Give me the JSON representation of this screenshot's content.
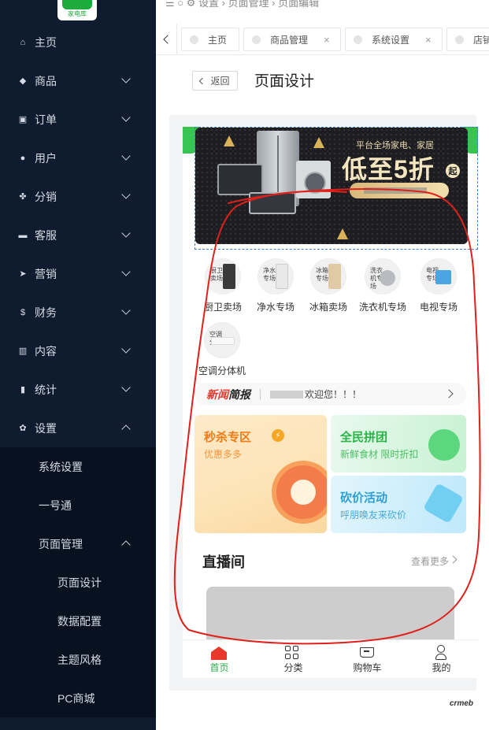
{
  "sidebar": {
    "logo_text": "家电库",
    "menu": [
      {
        "label": "主页",
        "icon": "home-icon",
        "glyph": "⌂"
      },
      {
        "label": "商品",
        "icon": "goods-bag-icon",
        "glyph": "◆"
      },
      {
        "label": "订单",
        "icon": "cart-icon",
        "glyph": "▣"
      },
      {
        "label": "用户",
        "icon": "user-icon",
        "glyph": "●"
      },
      {
        "label": "分销",
        "icon": "distribution-icon",
        "glyph": "✤"
      },
      {
        "label": "客服",
        "icon": "chat-icon",
        "glyph": "▬"
      },
      {
        "label": "营销",
        "icon": "send-icon",
        "glyph": "➤"
      },
      {
        "label": "财务",
        "icon": "dollar-icon",
        "glyph": "$"
      },
      {
        "label": "内容",
        "icon": "book-icon",
        "glyph": "▥"
      },
      {
        "label": "统计",
        "icon": "bar-chart-icon",
        "glyph": "▮"
      },
      {
        "label": "设置",
        "icon": "gear-icon",
        "glyph": "✿"
      }
    ],
    "settings_sub": [
      "系统设置",
      "一号通",
      "页面管理"
    ],
    "page_mgmt_sub": [
      "页面设计",
      "数据配置",
      "主题风格",
      "PC商城"
    ]
  },
  "topbar": {
    "breadcrumb": "☰   ○  ⚙ 设置  ›  页面管理  ›  页面编辑"
  },
  "tabs": [
    {
      "label": "主页",
      "closable": false
    },
    {
      "label": "商品管理",
      "closable": true
    },
    {
      "label": "系统设置",
      "closable": true
    },
    {
      "label": "店铺",
      "closable": false
    }
  ],
  "header": {
    "back_label": "返回",
    "title": "页面设计"
  },
  "phone": {
    "banner": {
      "subtitle": "平台全场家电、家居",
      "headline": "低至5折",
      "badge": "起"
    },
    "categories": [
      {
        "label": "厨卫卖场",
        "img_text": "厨卫卖场"
      },
      {
        "label": "净水专场",
        "img_text": "净水专场"
      },
      {
        "label": "冰箱卖场",
        "img_text": "冰箱专场"
      },
      {
        "label": "洗衣机专场",
        "img_text": "洗衣机专场"
      },
      {
        "label": "电视专场",
        "img_text": "电视专场"
      },
      {
        "label": "空调分体机",
        "img_text": "空调分体"
      }
    ],
    "news": {
      "label_a": "新闻",
      "label_b": "简报",
      "text": "欢迎您！！！"
    },
    "seckill": {
      "title": "秒杀专区",
      "subtitle": "优惠多多"
    },
    "group": {
      "title": "全民拼团",
      "subtitle": "新鲜食材 限时折扣"
    },
    "bargain": {
      "title": "砍价活动",
      "subtitle": "呼朋唤友来砍价"
    },
    "live": {
      "title": "直播间",
      "more": "查看更多"
    },
    "tabbar": [
      {
        "label": "首页",
        "icon": "home-icon"
      },
      {
        "label": "分类",
        "icon": "grid-icon"
      },
      {
        "label": "购物车",
        "icon": "cart-icon"
      },
      {
        "label": "我的",
        "icon": "user-icon"
      }
    ]
  },
  "footer": {
    "brand": "crmeb"
  },
  "colors": {
    "sidebar_bg": "#0f1b2e",
    "accent_green": "#2ea84a",
    "annotation_red": "#e0201a"
  }
}
